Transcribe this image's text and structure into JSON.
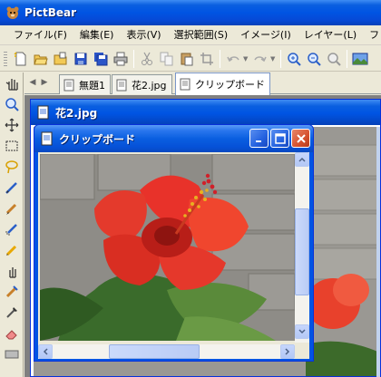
{
  "app": {
    "title": "PictBear"
  },
  "menu": [
    {
      "label": "ファイル(F)"
    },
    {
      "label": "編集(E)"
    },
    {
      "label": "表示(V)"
    },
    {
      "label": "選択範囲(S)"
    },
    {
      "label": "イメージ(I)"
    },
    {
      "label": "レイヤー(L)"
    },
    {
      "label": "フ"
    }
  ],
  "toolbar": {
    "buttons": [
      "new-icon",
      "open-icon",
      "open-folder-icon",
      "save-icon",
      "save-all-icon",
      "print-icon",
      "cut-icon",
      "copy-icon",
      "paste-icon",
      "crop-icon",
      "undo-icon",
      "redo-icon",
      "zoom-in-icon",
      "zoom-out-icon",
      "zoom-fit-icon",
      "image-view-icon"
    ]
  },
  "tools": [
    "hand-icon",
    "zoom-icon",
    "move-icon",
    "rect-select-icon",
    "lasso-icon",
    "pen-icon",
    "brush-icon",
    "airbrush-icon",
    "pencil-icon",
    "smudge-icon",
    "stamp-icon",
    "dropper-icon",
    "eraser-icon",
    "gradient-icon"
  ],
  "tabs": [
    {
      "label": "無題1"
    },
    {
      "label": "花2.jpg"
    },
    {
      "label": "クリップボード"
    }
  ],
  "docwindow": {
    "title": "花2.jpg"
  },
  "clipwindow": {
    "title": "クリップボード"
  },
  "colors": {
    "titlebar": "#0054e3",
    "flower": "#e8322a"
  }
}
